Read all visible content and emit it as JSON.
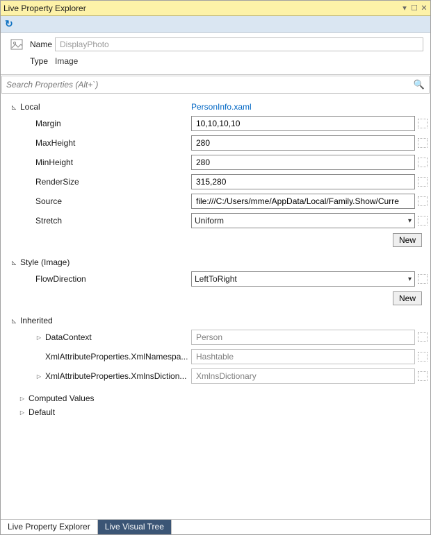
{
  "window": {
    "title": "Live Property Explorer"
  },
  "header": {
    "name_label": "Name",
    "name_value": "DisplayPhoto",
    "type_label": "Type",
    "type_value": "Image"
  },
  "search": {
    "placeholder": "Search Properties (Alt+`)"
  },
  "sections": {
    "local": {
      "label": "Local",
      "source_link": "PersonInfo.xaml",
      "props": {
        "margin": {
          "label": "Margin",
          "value": "10,10,10,10"
        },
        "maxheight": {
          "label": "MaxHeight",
          "value": "280"
        },
        "minheight": {
          "label": "MinHeight",
          "value": "280"
        },
        "rendersize": {
          "label": "RenderSize",
          "value": "315,280"
        },
        "source": {
          "label": "Source",
          "value": "file:///C:/Users/mme/AppData/Local/Family.Show/Curre"
        },
        "stretch": {
          "label": "Stretch",
          "value": "Uniform"
        }
      },
      "new_label": "New"
    },
    "style": {
      "label": "Style (Image)",
      "props": {
        "flowdirection": {
          "label": "FlowDirection",
          "value": "LeftToRight"
        }
      },
      "new_label": "New"
    },
    "inherited": {
      "label": "Inherited",
      "props": {
        "datacontext": {
          "label": "DataContext",
          "value": "Person"
        },
        "xmlns": {
          "label": "XmlAttributeProperties.XmlNamespa...",
          "value": "Hashtable"
        },
        "xmlnsdict": {
          "label": "XmlAttributeProperties.XmlnsDiction...",
          "value": "XmlnsDictionary"
        }
      }
    },
    "computed": {
      "label": "Computed Values"
    },
    "default": {
      "label": "Default"
    }
  },
  "tabs": {
    "active": "Live Property Explorer",
    "inactive": "Live Visual Tree"
  }
}
